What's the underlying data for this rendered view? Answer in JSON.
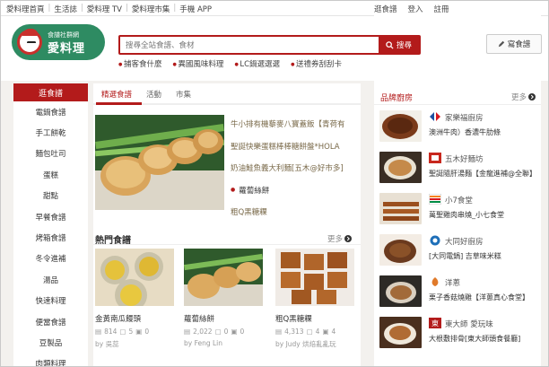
{
  "topbar": {
    "links": [
      "愛料理首頁",
      "生活誌",
      "愛料理 TV",
      "愛料理市集",
      "手機 APP"
    ],
    "right_links": [
      "逛食譜",
      "登入",
      "註冊"
    ]
  },
  "logo": {
    "small_text": "食譜社群網",
    "brand_text": "愛料理"
  },
  "search": {
    "placeholder": "搜尋全站食譜、食材",
    "button_label": "搜尋"
  },
  "hotlinks": [
    "捕客食什麼",
    "異國風味料理",
    "LC鍋選選選",
    "送禮券刮刮卡"
  ],
  "write_button": "寫食譜",
  "sidebar": {
    "header": "逛食譜",
    "categories": [
      "電鍋食譜",
      "手工餅乾",
      "麵包吐司",
      "蛋糕",
      "甜點",
      "早餐食譜",
      "烤箱食譜",
      "冬令進補",
      "湯品",
      "快速料理",
      "便當食譜",
      "豆製品",
      "肉類料理"
    ]
  },
  "main": {
    "tabs": [
      "精選食譜",
      "活動",
      "市集"
    ],
    "headlines": [
      "牛小排有機藜麥八寶蓋飯【青荷有",
      "聖誕快樂蛋糕棒棒糖餅盤*HOLA",
      "奶油鮭魚義大利麵[五木@好市多]",
      "蘿蔔絲餅",
      "粗Q黑糖粿"
    ],
    "popular_title": "熱門食譜",
    "more_label": "更多",
    "cards": [
      {
        "title": "金黃南瓜饅頭",
        "views": "814",
        "likes": "5",
        "comments": "0",
        "author": "by 吳蕊"
      },
      {
        "title": "蘿蔔絲餅",
        "views": "2,022",
        "likes": "0",
        "comments": "0",
        "author": "by Feng Lin"
      },
      {
        "title": "粗Q黑糖粿",
        "views": "4,313",
        "likes": "4",
        "comments": "4",
        "author": "by Judy 烘焙亂亂玩"
      }
    ]
  },
  "brands": {
    "title": "品牌廚房",
    "more_label": "更多",
    "items": [
      {
        "name": "家樂福廚房",
        "desc": "澳洲牛肉）香濃牛肋條"
      },
      {
        "name": "五木好麵坊",
        "desc": "聖誕隨肝湯麵【金龍進補@全聯】"
      },
      {
        "name": "小7食堂",
        "desc": "萬聖雞肉串燒_小七食堂"
      },
      {
        "name": "大同好廚房",
        "desc": "[大同電鍋] 吉草味米糕"
      },
      {
        "name": "洋蔥",
        "desc": "栗子香菇燒雞【洋蔥真心食堂】"
      },
      {
        "name": "東大師 愛玩味",
        "desc": "大根敷排骨[東大師頭食餐廳]"
      }
    ]
  },
  "colors": {
    "accent": "#b31b1b",
    "logo_green": "#2e8b62"
  }
}
